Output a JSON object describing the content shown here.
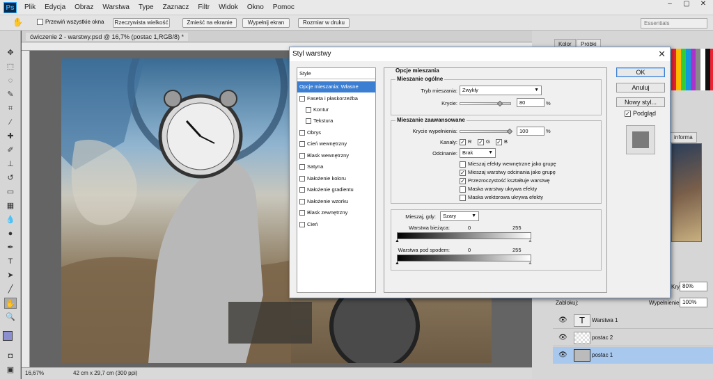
{
  "app": {
    "logo": "Ps"
  },
  "menu": [
    "Plik",
    "Edycja",
    "Obraz",
    "Warstwa",
    "Type",
    "Zaznacz",
    "Filtr",
    "Widok",
    "Okno",
    "Pomoc"
  ],
  "window_controls": [
    "–",
    "▢",
    "✕"
  ],
  "options_bar": {
    "scroll_all_label": "Przewiń wszystkie okna",
    "buttons": [
      "Rzeczywista wielkość",
      "Zmieść na ekranie",
      "Wypełnij ekran",
      "Rozmiar w druku"
    ],
    "workspace": "Essentials"
  },
  "document": {
    "tab_title": "ćwiczenie 2 - warstwy.psd @ 16,7% (postac 1,RGB/8) *",
    "zoom": "16,67%",
    "size": "42 cm x 29,7 cm (300 ppi)"
  },
  "right_panel": {
    "tabs_top": [
      "Kolor",
      "Próbki"
    ],
    "info_tab": "informa",
    "opacity_label": "Krycie:",
    "opacity": "80%",
    "lock_label": "Zablokuj:",
    "fill_label": "Wypełnienie:",
    "fill": "100%",
    "layers": [
      {
        "name": "Warstwa 1",
        "type": "text"
      },
      {
        "name": "postac 2",
        "type": "image"
      },
      {
        "name": "postac 1",
        "type": "image",
        "selected": true
      }
    ]
  },
  "dialog": {
    "title": "Styl warstwy",
    "close": "✕",
    "styles_header": "Style",
    "styles": [
      {
        "label": "Opcje mieszania: Własne",
        "selected": true,
        "checkbox": false,
        "indent": false
      },
      {
        "label": "Faseta i płaskorzeźba",
        "checkbox": true,
        "indent": false
      },
      {
        "label": "Kontur",
        "checkbox": true,
        "indent": true
      },
      {
        "label": "Tekstura",
        "checkbox": true,
        "indent": true
      },
      {
        "label": "Obrys",
        "checkbox": true,
        "indent": false
      },
      {
        "label": "Cień wewnętrzny",
        "checkbox": true,
        "indent": false
      },
      {
        "label": "Blask wewnętrzny",
        "checkbox": true,
        "indent": false
      },
      {
        "label": "Satyna",
        "checkbox": true,
        "indent": false
      },
      {
        "label": "Nałożenie koloru",
        "checkbox": true,
        "indent": false
      },
      {
        "label": "Nałożenie gradientu",
        "checkbox": true,
        "indent": false
      },
      {
        "label": "Nałożenie wzorku",
        "checkbox": true,
        "indent": false
      },
      {
        "label": "Blask zewnętrzny",
        "checkbox": true,
        "indent": false
      },
      {
        "label": "Cień",
        "checkbox": true,
        "indent": false
      }
    ],
    "blend_options_title": "Opcje mieszania",
    "general": {
      "title": "Mieszanie ogólne",
      "mode_label": "Tryb mieszania:",
      "mode": "Zwykły",
      "opacity_label": "Krycie:",
      "opacity": "80",
      "opacity_level": 0.8,
      "unit": "%"
    },
    "advanced": {
      "title": "Mieszanie zaawansowane",
      "fill_label": "Krycie wypełnienia:",
      "fill": "100",
      "fill_level": 1.0,
      "unit": "%",
      "channels_label": "Kanały:",
      "channels": [
        "R",
        "G",
        "B"
      ],
      "knockout_label": "Odcinanie:",
      "knockout": "Brak",
      "checkboxes": [
        {
          "label": "Mieszaj efekty wewnętrzne jako grupę",
          "checked": false
        },
        {
          "label": "Mieszaj warstwy odcinania jako grupę",
          "checked": true
        },
        {
          "label": "Przezroczystość kształtuje warstwę",
          "checked": true
        },
        {
          "label": "Maska warstwy ukrywa efekty",
          "checked": false
        },
        {
          "label": "Maska wektorowa ukrywa efekty",
          "checked": false
        }
      ]
    },
    "blend_if": {
      "label": "Mieszaj, gdy:",
      "value": "Szary",
      "this_layer_label": "Warstwa bieżąca:",
      "under_layer_label": "Warstwa pod spodem:",
      "min": "0",
      "max": "255"
    },
    "buttons": {
      "ok": "OK",
      "cancel": "Anuluj",
      "new_style": "Nowy styl...",
      "preview": "Podgląd"
    }
  }
}
